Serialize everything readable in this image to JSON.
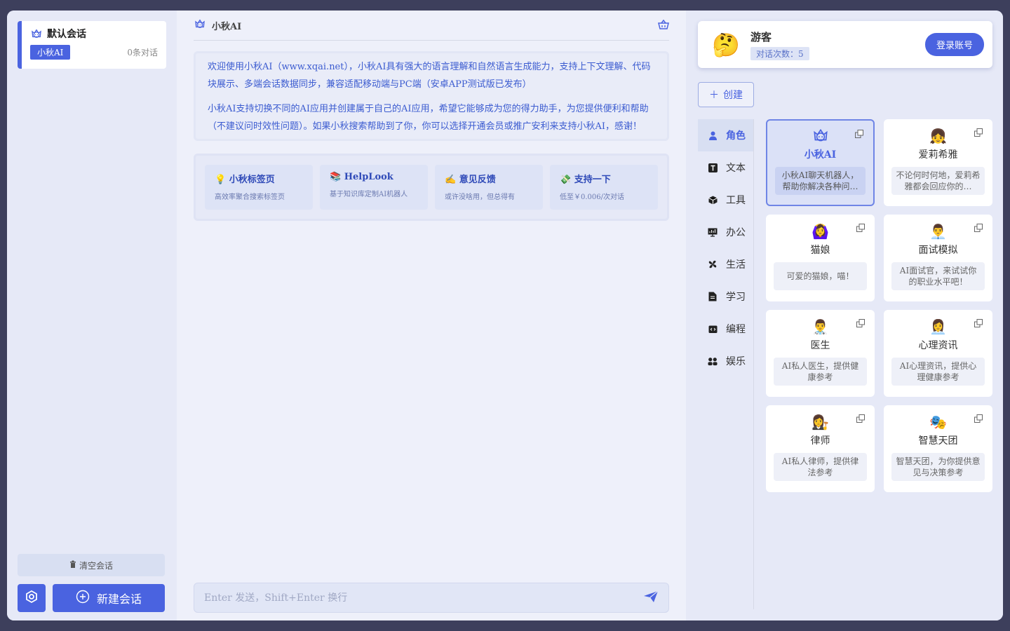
{
  "sidebar": {
    "conversation": {
      "title": "默认会话",
      "app_badge": "小秋AI",
      "count": "0条对话"
    },
    "clear_label": "清空会话",
    "new_chat_label": "新建会话"
  },
  "chat": {
    "header_title": "小秋AI",
    "welcome_p1": "欢迎使用小秋AI（www.xqai.net），小秋AI具有强大的语言理解和自然语言生成能力，支持上下文理解、代码块展示、多端会话数据同步，兼容适配移动端与PC端（安卓APP测试版已发布）",
    "welcome_p2": "小秋AI支持切换不同的AI应用并创建属于自己的AI应用，希望它能够成为您的得力助手，为您提供便利和帮助（不建议问时效性问题）。如果小秋搜索帮助到了你，你可以选择开通会员或推广安利来支持小秋AI，感谢！",
    "links": [
      {
        "icon": "💡",
        "title": "小秋标签页",
        "desc": "高效率聚合搜索标签页"
      },
      {
        "icon": "📚",
        "title": "HelpLook",
        "desc": "基于知识库定制AI机器人"
      },
      {
        "icon": "✍️",
        "title": "意见反馈",
        "desc": "或许没啥用，但总得有"
      },
      {
        "icon": "💸",
        "title": "支持一下",
        "desc": "低至￥0.006/次对话"
      }
    ],
    "input_placeholder": "Enter 发送，Shift+Enter 换行"
  },
  "user": {
    "avatar": "🤔",
    "name": "游客",
    "count": "对话次数：5",
    "login_label": "登录账号"
  },
  "create_label": "创建",
  "categories": [
    "角色",
    "文本",
    "工具",
    "办公",
    "生活",
    "学习",
    "编程",
    "娱乐"
  ],
  "apps": [
    {
      "emoji": "",
      "name": "小秋AI",
      "desc": "小秋AI聊天机器人，帮助你解决各种问…"
    },
    {
      "emoji": "👧",
      "name": "爱莉希雅",
      "desc": "不论何时何地，爱莉希雅都会回应你的…"
    },
    {
      "emoji": "🙆‍♀️",
      "name": "猫娘",
      "desc": "可爱的猫娘，喵！"
    },
    {
      "emoji": "👨‍💼",
      "name": "面试模拟",
      "desc": "AI面试官，来试试你的职业水平吧！"
    },
    {
      "emoji": "👨‍⚕️",
      "name": "医生",
      "desc": "AI私人医生，提供健康参考"
    },
    {
      "emoji": "👩‍💼",
      "name": "心理资讯",
      "desc": "AI心理资讯，提供心理健康参考"
    },
    {
      "emoji": "👩‍⚖️",
      "name": "律师",
      "desc": "AI私人律师，提供律法参考"
    },
    {
      "emoji": "🎭",
      "name": "智慧天团",
      "desc": "智慧天团，为你提供意见与决策参考"
    }
  ],
  "colors": {
    "accent": "#4a63e0",
    "frame": "#3d3f5c"
  }
}
